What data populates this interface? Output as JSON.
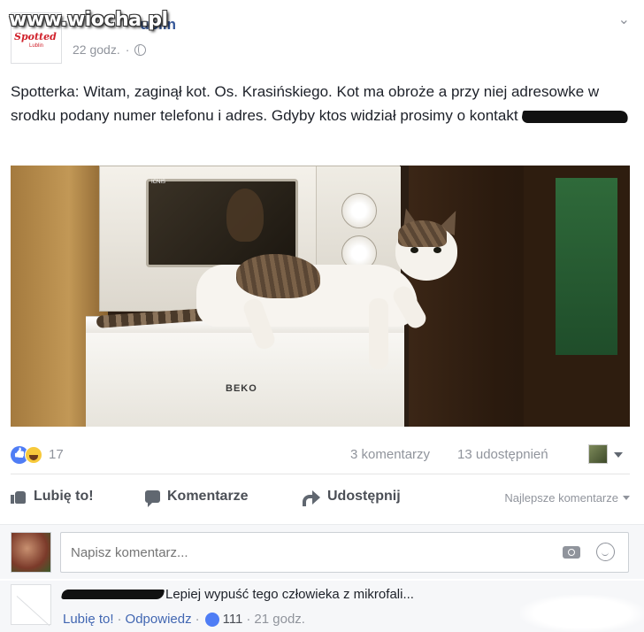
{
  "watermark": "www.wiocha.pl",
  "post": {
    "page_name_suffix": "ublin",
    "page_logo_text": "Spotted",
    "page_logo_sub": "Lublin",
    "time": "22 godz.",
    "menu": "⌄",
    "text": "Spotterka: Witam, zaginął kot. Os. Krasińskiego. Kot ma obroże a przy niej adresowke w srodku podany numer telefonu i adres. Gdyby ktos widział prosimy o kontakt",
    "photo_brand": "BEKO",
    "photo_brand_small": "ICNIS"
  },
  "stats": {
    "reactions": "17",
    "comments": "3 komentarzy",
    "shares": "13 udostępnień"
  },
  "actions": {
    "like": "Lubię to!",
    "comment": "Komentarze",
    "share": "Udostępnij",
    "sort": "Najlepsze komentarze"
  },
  "composer": {
    "placeholder": "Napisz komentarz..."
  },
  "comment": {
    "text": "Lepiej wypuść tego człowieka z mikrofali...",
    "like": "Lubię to!",
    "reply": "Odpowiedz",
    "likes": "111",
    "time": "21 godz.",
    "separator": "·"
  },
  "colors": {
    "link": "#365899",
    "meta": "#90949c",
    "accent": "#4267b2",
    "background_light": "#f6f7f9"
  }
}
